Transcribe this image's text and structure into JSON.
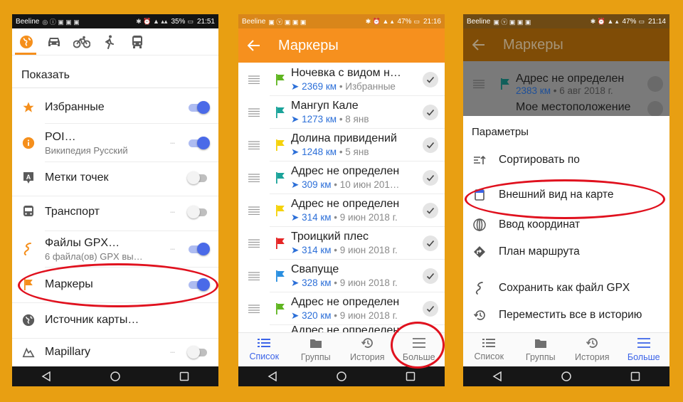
{
  "phone1": {
    "status": {
      "carrier": "Beeline",
      "battery": "35%",
      "time": "21:51"
    },
    "modes": [
      "globe-icon",
      "car-icon",
      "bicycle-icon",
      "pedestrian-icon",
      "bus-icon"
    ],
    "section_title": "Показать",
    "items": [
      {
        "title": "Избранные",
        "subtitle": "",
        "toggle": true,
        "icon": "star-icon"
      },
      {
        "title": "POI…",
        "subtitle": "Википедия Русский",
        "toggle": true,
        "icon": "poi-info-icon"
      },
      {
        "title": "Метки точек",
        "subtitle": "",
        "toggle": false,
        "icon": "point-label-icon"
      },
      {
        "title": "Транспорт",
        "subtitle": "",
        "toggle": false,
        "icon": "bus-icon"
      },
      {
        "title": "Файлы GPX…",
        "subtitle": "6 файла(ов) GPX вы…",
        "toggle": true,
        "icon": "gpx-track-icon"
      },
      {
        "title": "Маркеры",
        "subtitle": "",
        "toggle": true,
        "icon": "flag-icon"
      },
      {
        "title": "Источник карты…",
        "subtitle": "",
        "toggle": null,
        "icon": "globe-icon"
      },
      {
        "title": "Mapillary",
        "subtitle": "",
        "toggle": false,
        "icon": "mapillary-icon"
      }
    ]
  },
  "phone2": {
    "status": {
      "carrier": "Beeline",
      "battery": "47%",
      "time": "21:16"
    },
    "title": "Маркеры",
    "markers": [
      {
        "name": "Ночевка с видом н…",
        "distance": "2369 км",
        "info": "• Избранные",
        "flag": "#5fb520"
      },
      {
        "name": "Мангуп Кале",
        "distance": "1273 км",
        "info": "• 8 янв",
        "flag": "#1aa39a"
      },
      {
        "name": "Долина привидений",
        "distance": "1248 км",
        "info": "• 5 янв",
        "flag": "#f5d20a"
      },
      {
        "name": "Адрес не определен",
        "distance": "309 км",
        "info": "• 10 июн 201…",
        "flag": "#1aa39a"
      },
      {
        "name": "Адрес не определен",
        "distance": "314 км",
        "info": "• 9 июн 2018 г.",
        "flag": "#f5d20a"
      },
      {
        "name": "Троицкий плес",
        "distance": "314 км",
        "info": "• 9 июн 2018 г.",
        "flag": "#e52525"
      },
      {
        "name": "Свапуще",
        "distance": "328 км",
        "info": "• 9 июн 2018 г.",
        "flag": "#2a8fe0"
      },
      {
        "name": "Адрес не определен",
        "distance": "320 км",
        "info": "• 9 июн 2018 г.",
        "flag": "#5fb520"
      }
    ],
    "peek": "Адрес не определен",
    "bottom_nav": [
      "Список",
      "Группы",
      "История",
      "Больше"
    ]
  },
  "phone3": {
    "status": {
      "carrier": "Beeline",
      "battery": "47%",
      "time": "21:14"
    },
    "title": "Маркеры",
    "dimmed_markers": [
      {
        "name": "Адрес не определен",
        "distance": "2383 км",
        "info": "• 6 авг 2018 г."
      },
      {
        "name": "Мое местоположение",
        "distance": "",
        "info": ""
      }
    ],
    "sheet_title": "Параметры",
    "options": [
      {
        "label": "Сортировать по",
        "icon": "sort-icon"
      },
      {
        "label": "Внешний вид на карте",
        "icon": "appearance-icon"
      },
      {
        "label": "Ввод координат",
        "icon": "coordinates-icon"
      },
      {
        "label": "План маршрута",
        "icon": "route-plan-icon"
      },
      {
        "label": "Сохранить как файл GPX",
        "icon": "save-gpx-icon"
      },
      {
        "label": "Переместить все в историю",
        "icon": "history-icon"
      }
    ],
    "bottom_nav": [
      "Список",
      "Группы",
      "История",
      "Больше"
    ]
  },
  "colors": {
    "background": "#E89F12",
    "toolbar": "#F6901E",
    "accent": "#3b63e8",
    "highlight": "#E0111E",
    "distance": "#2c6fd8"
  }
}
